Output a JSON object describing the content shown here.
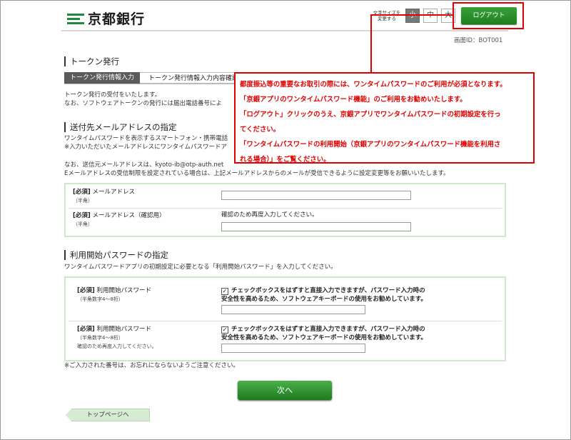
{
  "header": {
    "logo_text": "京都銀行",
    "font_size_label": "文字サイズを変更する",
    "font_size_small": "小",
    "font_size_medium": "中",
    "font_size_large": "大",
    "logout_label": "ログアウト",
    "screen_id": "画面ID：BOT001"
  },
  "page": {
    "title": "トークン発行",
    "steps": [
      "トークン発行情報入力",
      "トークン発行情報入力内容確認"
    ],
    "intro_line1": "トークン発行の受付をいたします。",
    "intro_line2": "なお、ソフトウェアトークンの発行には届出電話番号によ"
  },
  "email_section": {
    "title": "送付先メールアドレスの指定",
    "desc_line1": "ワンタイムパスワードを表示するスマートフォン・携帯電話",
    "desc_line2": "※入力いただいたメールアドレスにワンタイムパスワードア",
    "note_line1": "なお、送信元メールアドレスは、kyoto-ib@otp-auth.net",
    "note_line2": "Eメールアドレスの受信制限を設定されている場合は、上記メールアドレスからのメールが受信できるように設定変更等をお願いいたします。",
    "required": "[必須]",
    "email_label": "メールアドレス",
    "email_sub": "（半角）",
    "confirm_label": "メールアドレス（確認用）",
    "confirm_sub": "（半角）",
    "confirm_hint": "確認のため再度入力してください。",
    "email_value": "",
    "confirm_value": ""
  },
  "password_section": {
    "title": "利用開始パスワードの指定",
    "desc": "ワンタイムパスワードアプリの初期設定に必要となる「利用開始パスワード」を入力してください。",
    "required": "[必須]",
    "label": "利用開始パスワード",
    "sub": "（半角数字4～8桁）",
    "confirm_label": "利用開始パスワード",
    "confirm_sub": "（半角数字4～8桁）",
    "confirm_hint": "確認のため再度入力してください。",
    "checkbox_line1": "チェックボックスをはずすと直接入力できますが、パスワード入力時の",
    "checkbox_line2": "安全性を高めるため、ソフトウェアキーボードの使用をお勧めしています。",
    "checkbox_checked": true,
    "note": "※ご入力された番号は、お忘れにならないようご注意ください。"
  },
  "actions": {
    "next_label": "次へ",
    "top_label": "トップページへ"
  },
  "callout": {
    "line1": "都度振込等の重要なお取引の際には、ワンタイムパスワードのご利用が必須となります。",
    "line2": "「京銀アプリのワンタイムパスワード機能」のご利用をお勧めいたします。",
    "line3": "「ログアウト」クリックのうえ、京銀アプリでワンタイムパスワードの初期設定を行っ",
    "line4": "てください。",
    "line5": "「ワンタイムパスワードの利用開始（京銀アプリのワンタイムパスワード機能を利用さ",
    "line6": "れる場合）」をご覧ください。"
  },
  "colors": {
    "brand_green": "#1d8a3c",
    "annotation_red": "#e00000"
  }
}
